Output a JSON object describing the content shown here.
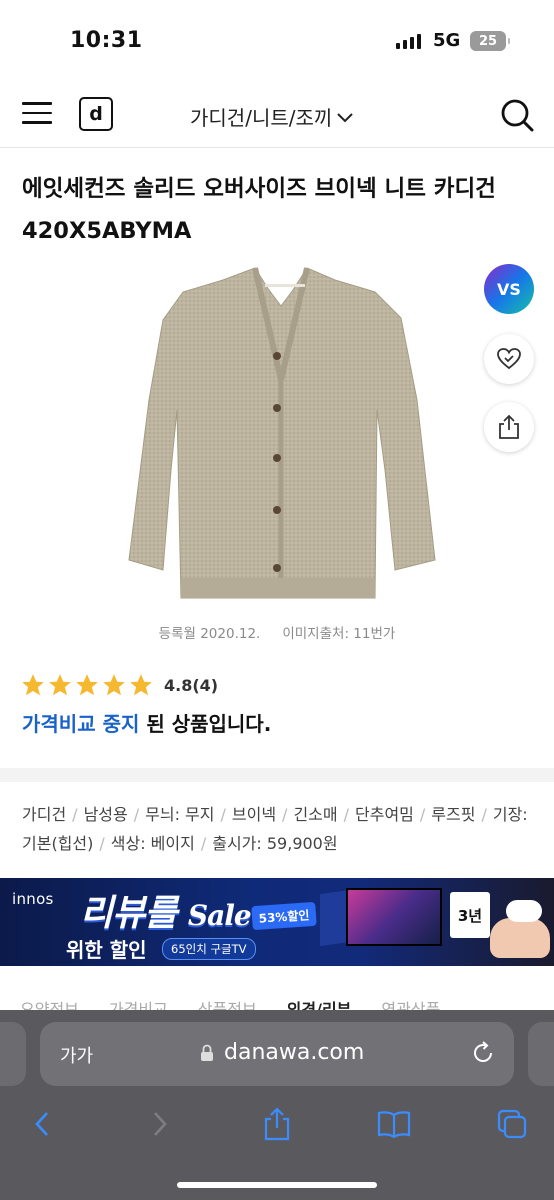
{
  "status_bar": {
    "time": "10:31",
    "network": "5G",
    "battery": "25"
  },
  "header": {
    "logo_letter": "d",
    "category": "가디건/니트/조끼"
  },
  "product": {
    "title": "에잇세컨즈 솔리드 오버사이즈 브이넥 니트 카디건 420X5ABYMA",
    "registered": "등록월 2020.12.",
    "image_source": "이미지출처: 11번가",
    "vs_label": "VS",
    "rating": "4.8",
    "review_count": "(4)",
    "status_blue": "가격비교 중지",
    "status_rest": " 된 상품입니다."
  },
  "specs": [
    "가디건",
    "남성용",
    "무늬: 무지",
    "브이넥",
    "긴소매",
    "단추여밈",
    "루즈핏",
    "기장: 기본(힙선)",
    "색상: 베이지",
    "출시가: 59,900원"
  ],
  "banner": {
    "brand": "innos",
    "headline": "리뷰를",
    "headline_script": "Sale",
    "sub1": "위한 할인",
    "sub2": "65인치 구글TV",
    "percent": "53%할인",
    "warranty": "3년"
  },
  "tabs": [
    "요약정보",
    "가격비교",
    "상품정보",
    "의견/리뷰",
    "연관상품"
  ],
  "browser": {
    "text_size": "가가",
    "url": "danawa.com"
  },
  "colors": {
    "accent_blue": "#1a62c8",
    "star": "#f5b82e",
    "browser_bg": "#5a5a5e"
  }
}
